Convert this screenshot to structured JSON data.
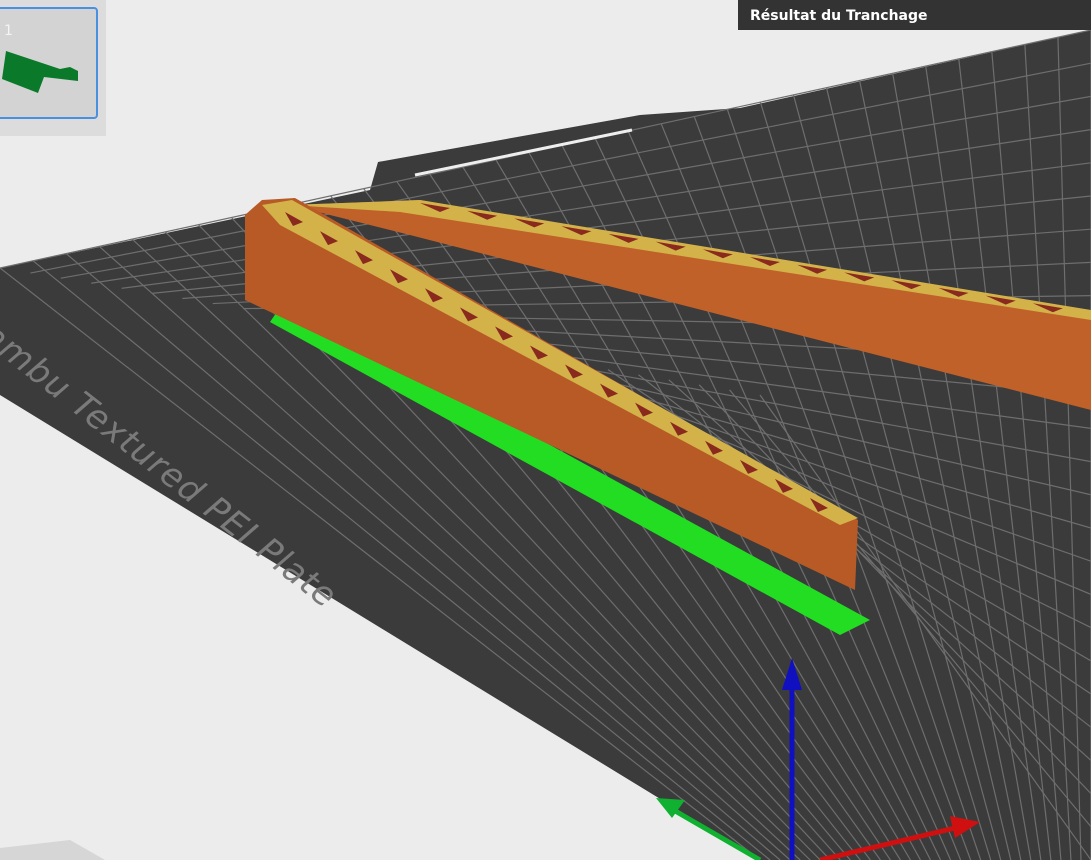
{
  "slice_result": {
    "title": "Résultat du Tranchage"
  },
  "plate": {
    "label": "Bambu Textured PEI Plate",
    "number": "1"
  },
  "colors": {
    "plate": "#3b3b3b",
    "grid": "#6a6a6a",
    "wall": "#c0612a",
    "infill": "#d4b24a",
    "inner": "#8a2a1e",
    "brim": "#22dd22",
    "thumb_part": "#0a7a2a",
    "x_axis": "#d01010",
    "y_axis": "#10b030",
    "z_axis": "#1010c0"
  }
}
